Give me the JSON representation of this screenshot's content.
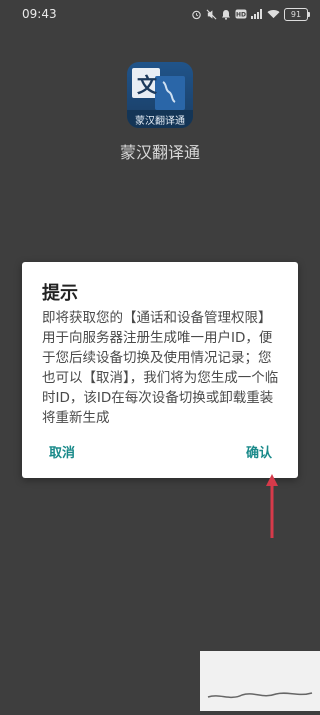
{
  "status": {
    "time": "09:43",
    "battery": "91"
  },
  "app": {
    "logo_glyph": "文",
    "logo_caption": "蒙汉翻译通",
    "name": "蒙汉翻译通"
  },
  "dialog": {
    "title": "提示",
    "message": "即将获取您的【通话和设备管理权限】用于向服务器注册生成唯一用户ID，便于您后续设备切换及使用情况记录；您也可以【取消】，我们将为您生成一个临时ID，该ID在每次设备切换或卸载重装将重新生成",
    "cancel_label": "取消",
    "confirm_label": "确认"
  },
  "colors": {
    "background": "#3e3e3e",
    "accent": "#1a8a8a",
    "annotation_arrow": "#d63a4a"
  },
  "icons": [
    "alarm-icon",
    "mute-icon",
    "notification-icon",
    "hd-icon",
    "signal-icon",
    "wifi-icon",
    "battery-icon",
    "app-logo-icon",
    "annotation-arrow-icon"
  ]
}
